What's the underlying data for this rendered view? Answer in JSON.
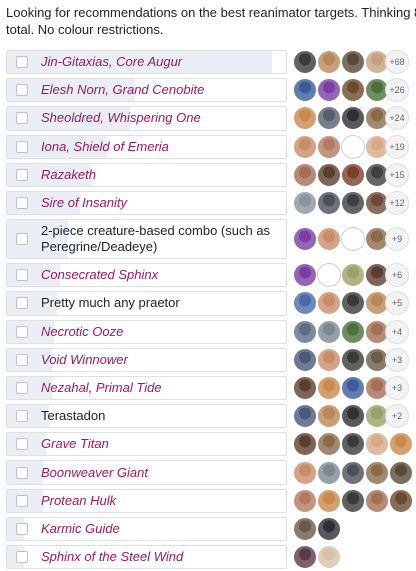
{
  "post": {
    "text": "Looking for recommendations on the best reanimator targets. Thinking 8-total. No colour restrictions."
  },
  "poll": {
    "options": [
      {
        "label": "Jin-Gitaxias, Core Augur",
        "style": "card",
        "fill": 0.95,
        "voters": [
          "#3a3a3a",
          "#b8875a",
          "#5a4a3a",
          "#c4a27e"
        ],
        "more": "+68"
      },
      {
        "label": "Elesh Norn, Grand Cenobite",
        "style": "card",
        "fill": 0.46,
        "voters": [
          "#3b5b9a",
          "#7a3fa3",
          "#6b4a2e",
          "#4f6f3a"
        ],
        "more": "+26"
      },
      {
        "label": "Sheoldred, Whispering One",
        "style": "card",
        "fill": 0.44,
        "voters": [
          "#c9894f",
          "#55606e",
          "#2f2f35",
          "#8a6a4a"
        ],
        "more": "+24"
      },
      {
        "label": "Iona, Shield of Emeria",
        "style": "card",
        "fill": 0.36,
        "voters": [
          "#c98c6a",
          "#b37a63",
          "#ffffff",
          "#d7a988"
        ],
        "more": "+19"
      },
      {
        "label": "Razaketh",
        "style": "card",
        "fill": 0.3,
        "voters": [
          "#a46f57",
          "#5b3e2f",
          "#7a3f2a",
          "#3f3f3f"
        ],
        "more": "+15"
      },
      {
        "label": "Sire of Insanity",
        "style": "card",
        "fill": 0.26,
        "voters": [
          "#8a93a0",
          "#4b4f58",
          "#3d3d44",
          "#6b4a38"
        ],
        "more": "+12"
      },
      {
        "label": "2-piece creature-based combo (such as Peregrine/Deadeye)",
        "style": "plain",
        "fill": 0.22,
        "voters": [
          "#7a3fa3",
          "#c98c6a",
          "#ffffff",
          "#8a6a4a"
        ],
        "more": "+9"
      },
      {
        "label": "Consecrated Sphinx",
        "style": "card",
        "fill": 0.19,
        "voters": [
          "#7a3fa3",
          "#ffffff",
          "#9aa06a",
          "#5b3e2f"
        ],
        "more": "+6"
      },
      {
        "label": "Pretty much any praetor",
        "style": "plain",
        "fill": 0.18,
        "voters": [
          "#4c6aa8",
          "#c98c6a",
          "#3a3a3a",
          "#b8875a"
        ],
        "more": "+5"
      },
      {
        "label": "Necrotic Ooze",
        "style": "card",
        "fill": 0.17,
        "voters": [
          "#5a6e8a",
          "#7b8892",
          "#4f6f3a",
          "#a46f57"
        ],
        "more": "+4"
      },
      {
        "label": "Void Winnower",
        "style": "card",
        "fill": 0.16,
        "voters": [
          "#4a5a7a",
          "#c98c6a",
          "#3a3a3a",
          "#6e5a48"
        ],
        "more": "+3"
      },
      {
        "label": "Nezahal, Primal Tide",
        "style": "card",
        "fill": 0.16,
        "voters": [
          "#5b3e2f",
          "#c9894f",
          "#3b5b9a",
          "#a46f57"
        ],
        "more": "+3"
      },
      {
        "label": "Terastadon",
        "style": "plain",
        "fill": 0.15,
        "voters": [
          "#4a5a7a",
          "#b8875a",
          "#2f2f35",
          "#9aa06a"
        ],
        "more": "+2"
      },
      {
        "label": "Grave Titan",
        "style": "card",
        "fill": 0.14,
        "voters": [
          "#5b3e2f",
          "#8a6a4a",
          "#3a3a3a",
          "#d7a988",
          "#c9894f"
        ],
        "more": ""
      },
      {
        "label": "Boonweaver Giant",
        "style": "card",
        "fill": 0.13,
        "voters": [
          "#c98c6a",
          "#7b8892",
          "#4b4f58",
          "#8a6a4a",
          "#5a4a3a"
        ],
        "more": ""
      },
      {
        "label": "Protean Hulk",
        "style": "card",
        "fill": 0.13,
        "voters": [
          "#b37a63",
          "#c9894f",
          "#3a3a3a",
          "#a46f57",
          "#6b4a2e"
        ],
        "more": ""
      },
      {
        "label": "Karmic Guide",
        "style": "card",
        "fill": 0.06,
        "voters": [
          "#6b5a4a",
          "#2f2f35"
        ],
        "more": ""
      },
      {
        "label": "Sphinx of the Steel Wind",
        "style": "card",
        "fill": 0.06,
        "voters": [
          "#5a3a4a",
          "#d7c2a8"
        ],
        "more": ""
      }
    ]
  }
}
